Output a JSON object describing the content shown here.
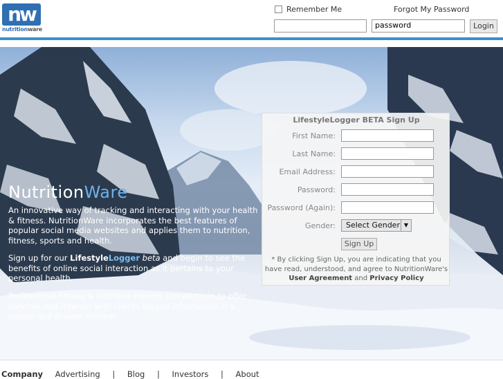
{
  "header": {
    "logo_mark": "nw",
    "logo_word_a": "nutrition",
    "logo_word_b": "ware",
    "remember_me": "Remember Me",
    "forgot_password": "Forgot My Password",
    "username_value": "",
    "password_value": "password",
    "login_label": "Login"
  },
  "hero": {
    "brand_a": "Nutrition",
    "brand_b": "Ware",
    "p1": "An innovative way of tracking and interacting with your health & fitness. NutritionWare incorporates the best features of popular social media websites and applies them to nutrition, fitness, sports and health.",
    "p2_a": "Sign up for our ",
    "p2_b": "Lifestyle",
    "p2_c": "Logger",
    "p2_d": "beta",
    "p2_e": " and begin to see the benefits of online social interaction as it pertains to your personal health.",
    "p3": "Professional fitness & nutrition experts can also join to offer services and interact with clients logged information in a secure and private manner."
  },
  "signup": {
    "title": "LifestyleLogger BETA Sign Up",
    "first_name": "First Name:",
    "last_name": "Last Name:",
    "email": "Email Address:",
    "password": "Password:",
    "password_again": "Password (Again):",
    "gender": "Gender:",
    "gender_selected": "Select Gender",
    "signup_button": "Sign Up",
    "disclaimer_a": "* By clicking Sign Up, you are indicating that you have read, understood, and agree to NutritionWare's ",
    "user_agreement": "User Agreement",
    "and": " and ",
    "privacy_policy": "Privacy Policy"
  },
  "footer": {
    "company": "Company",
    "advertising": "Advertising",
    "blog": "Blog",
    "investors": "Investors",
    "about": "About",
    "separator": "|"
  },
  "colors": {
    "accent": "#3a8ed0",
    "brand_blue": "#2f6fb2"
  }
}
